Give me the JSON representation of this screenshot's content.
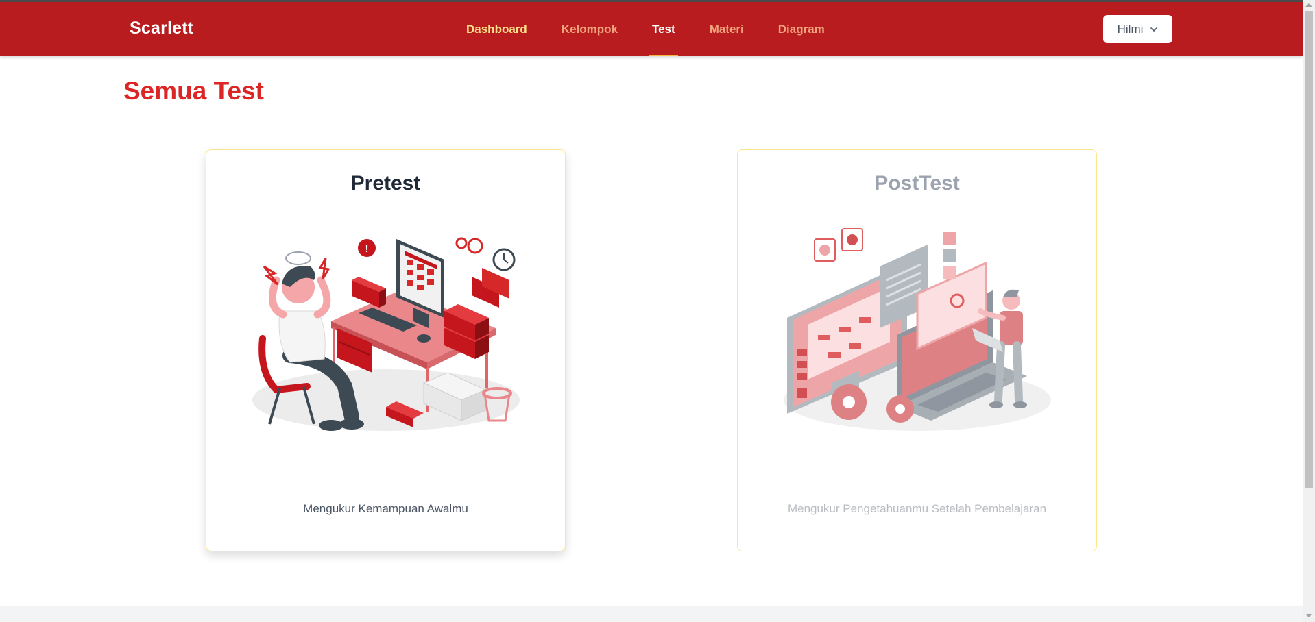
{
  "navbar": {
    "brand": "Scarlett",
    "links": [
      {
        "label": "Dashboard"
      },
      {
        "label": "Kelompok"
      },
      {
        "label": "Test"
      },
      {
        "label": "Materi"
      },
      {
        "label": "Diagram"
      }
    ],
    "user": {
      "name": "Hilmi",
      "icon": "chevron-down-icon"
    }
  },
  "page": {
    "title": "Semua Test"
  },
  "cards": [
    {
      "title": "Pretest",
      "description": "Mengukur Kemampuan Awalmu",
      "illustration": "stressed-person-at-desk-illustration"
    },
    {
      "title": "PostTest",
      "description": "Mengukur Pengetahuanmu Setelah Pembelajaran",
      "illustration": "developer-with-screens-illustration"
    }
  ],
  "colors": {
    "navbar": "#b81c1e",
    "accent": "#dc2626",
    "active_underline": "#f9b53c"
  }
}
